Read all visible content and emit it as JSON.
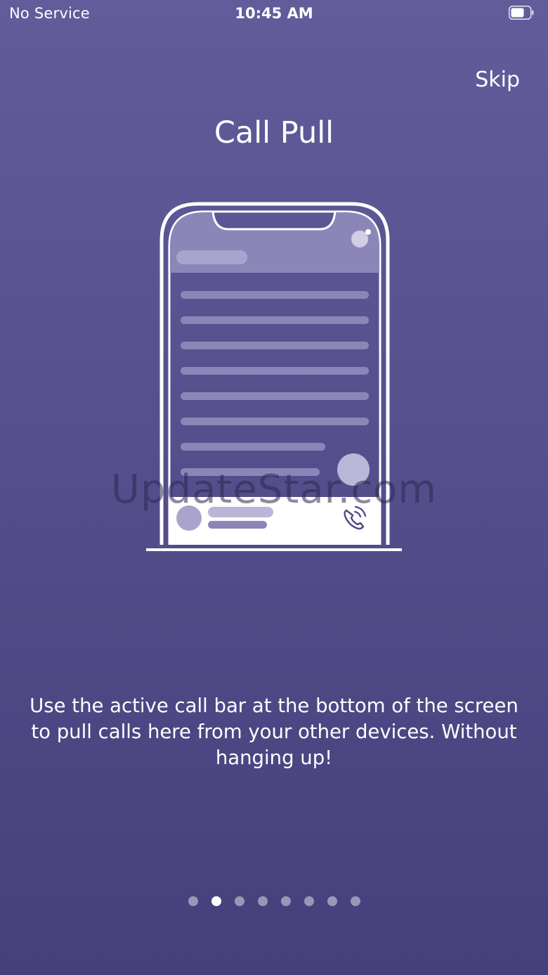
{
  "status_bar": {
    "carrier": "No Service",
    "time": "10:45 AM",
    "battery_icon": "battery-icon"
  },
  "header": {
    "skip_label": "Skip"
  },
  "main": {
    "title": "Call Pull",
    "description": "Use the active call bar at the bottom of the screen to pull calls here from your other devices. Without hanging up!",
    "illustration_icon": "phone-call-pull-illustration"
  },
  "watermark": "UpdateStar.com",
  "pagination": {
    "total": 8,
    "active_index": 1
  },
  "colors": {
    "background_top": "#625c9a",
    "background_bottom": "#453f7b",
    "accent": "#514a85",
    "text": "#ffffff"
  }
}
